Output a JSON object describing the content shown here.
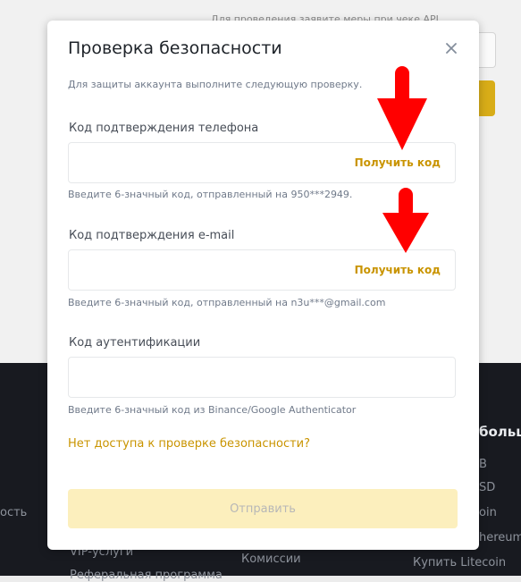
{
  "background": {
    "hint_text": "Для проведения заявите меры при чеке API",
    "footer_left": "ость",
    "footer_vip": "VIP-услуги",
    "footer_more": "Реферальная программа",
    "footer_fees": "Комиссии",
    "footer_title": "больш",
    "footer_right": [
      "B",
      "SD",
      "oin",
      "hereum",
      "Купить Litecoin"
    ]
  },
  "modal": {
    "title": "Проверка безопасности",
    "subtitle": "Для защиты аккаунта выполните следующую проверку.",
    "phone": {
      "label": "Код подтверждения телефона",
      "value": "",
      "get_code": "Получить код",
      "hint": "Введите 6-значный код, отправленный на 950***2949."
    },
    "email": {
      "label": "Код подтверждения e-mail",
      "value": "",
      "get_code": "Получить код",
      "hint": "Введите 6-значный код, отправленный на n3u***@gmail.com"
    },
    "auth": {
      "label": "Код аутентификации",
      "value": "",
      "hint": "Введите 6-значный код из Binance/Google Authenticator"
    },
    "no_access_link": "Нет доступа к проверке безопасности?",
    "submit_label": "Отправить"
  },
  "colors": {
    "accent": "#c99400",
    "submit_disabled_bg": "#fcefbd",
    "annotation_arrow": "#ff0000"
  },
  "icons": [
    "close-icon",
    "annotation-arrow-icon"
  ]
}
